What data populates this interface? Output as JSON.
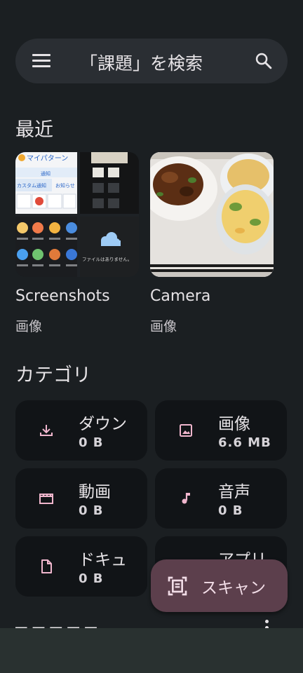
{
  "search": {
    "title": "「課題」を検索"
  },
  "recent": {
    "heading": "最近",
    "items": [
      {
        "label": "Screenshots",
        "subtitle": "画像"
      },
      {
        "label": "Camera",
        "subtitle": "画像"
      }
    ],
    "screenshot_thumb": {
      "header": "マイパターン",
      "notice": "通知",
      "custom_notice": "カスタム通知",
      "info": "お知らせ",
      "empty": "ファイルはありません。"
    }
  },
  "categories": {
    "heading": "カテゴリ",
    "items": [
      {
        "name": "ダウン",
        "size": "0 B",
        "icon": "download-icon"
      },
      {
        "name": "画像",
        "size": "6.6 MB",
        "icon": "image-icon"
      },
      {
        "name": "動画",
        "size": "0 B",
        "icon": "movie-icon"
      },
      {
        "name": "音声",
        "size": "0 B",
        "icon": "music-note-icon"
      },
      {
        "name": "ドキュ",
        "size": "0 B",
        "icon": "document-icon"
      },
      {
        "name": "アプリ",
        "size": "",
        "icon": "android-icon"
      }
    ]
  },
  "fab": {
    "label": "スキャン",
    "icon": "document-scanner-icon"
  },
  "colors": {
    "background": "#1b1f22",
    "card": "#111417",
    "accent_icon": "#f0b6cd",
    "fab": "#5c3f4c"
  }
}
